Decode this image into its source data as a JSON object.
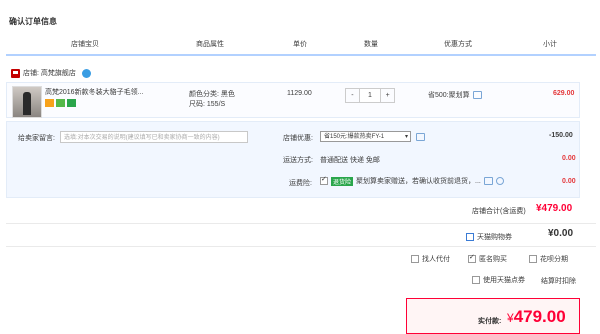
{
  "page_title": "确认订单信息",
  "columns": [
    "店铺宝贝",
    "商品属性",
    "单价",
    "数量",
    "优惠方式",
    "小计"
  ],
  "shop": {
    "label": "店铺: 高梵旗舰店"
  },
  "item": {
    "name": "高梵2016新款冬装大貉子毛领...",
    "attr_color": "颜色分类: 黑色",
    "attr_size": "尺码: 155/S",
    "price": "1129.00",
    "quantity": "1",
    "qty_minus": "-",
    "qty_plus": "+",
    "discount": "省500:聚划算",
    "subtotal": "629.00"
  },
  "extras": {
    "message_label": "给卖家留言:",
    "message_placeholder": "选填:对本次交易的说明(建议填写已和卖家协商一致的内容)",
    "shop_discount_label": "店铺优惠:",
    "shop_discount_value": "省150元:爆款热卖FY-1",
    "shop_discount_amount": "-150.00",
    "shipping_label": "运送方式:",
    "shipping_value": "普通配送 快递 免邮",
    "shipping_amount": "0.00",
    "insurance_label": "运费险:",
    "insurance_tag": "退货险",
    "insurance_text": "聚划算卖家赠送，若确认收货前退货，...",
    "insurance_amount": "0.00"
  },
  "store_total": {
    "label": "店铺合计(含运费)",
    "value": "¥479.00"
  },
  "tmall_coupon": {
    "label": "天猫购物券",
    "value": "¥0.00"
  },
  "options": {
    "proxy_pay": "找人代付",
    "anonymous": "匿名购买",
    "huabei": "花呗分期",
    "tmall_points": "使用天猫点券",
    "settle_deduct": "结算时扣除"
  },
  "payment": {
    "label": "实付款:",
    "currency": "¥",
    "amount": "479.00"
  },
  "colors": {
    "accent": "#ff0036",
    "header_border": "#b2d1ff",
    "extras_bg": "#f2f7ff"
  }
}
